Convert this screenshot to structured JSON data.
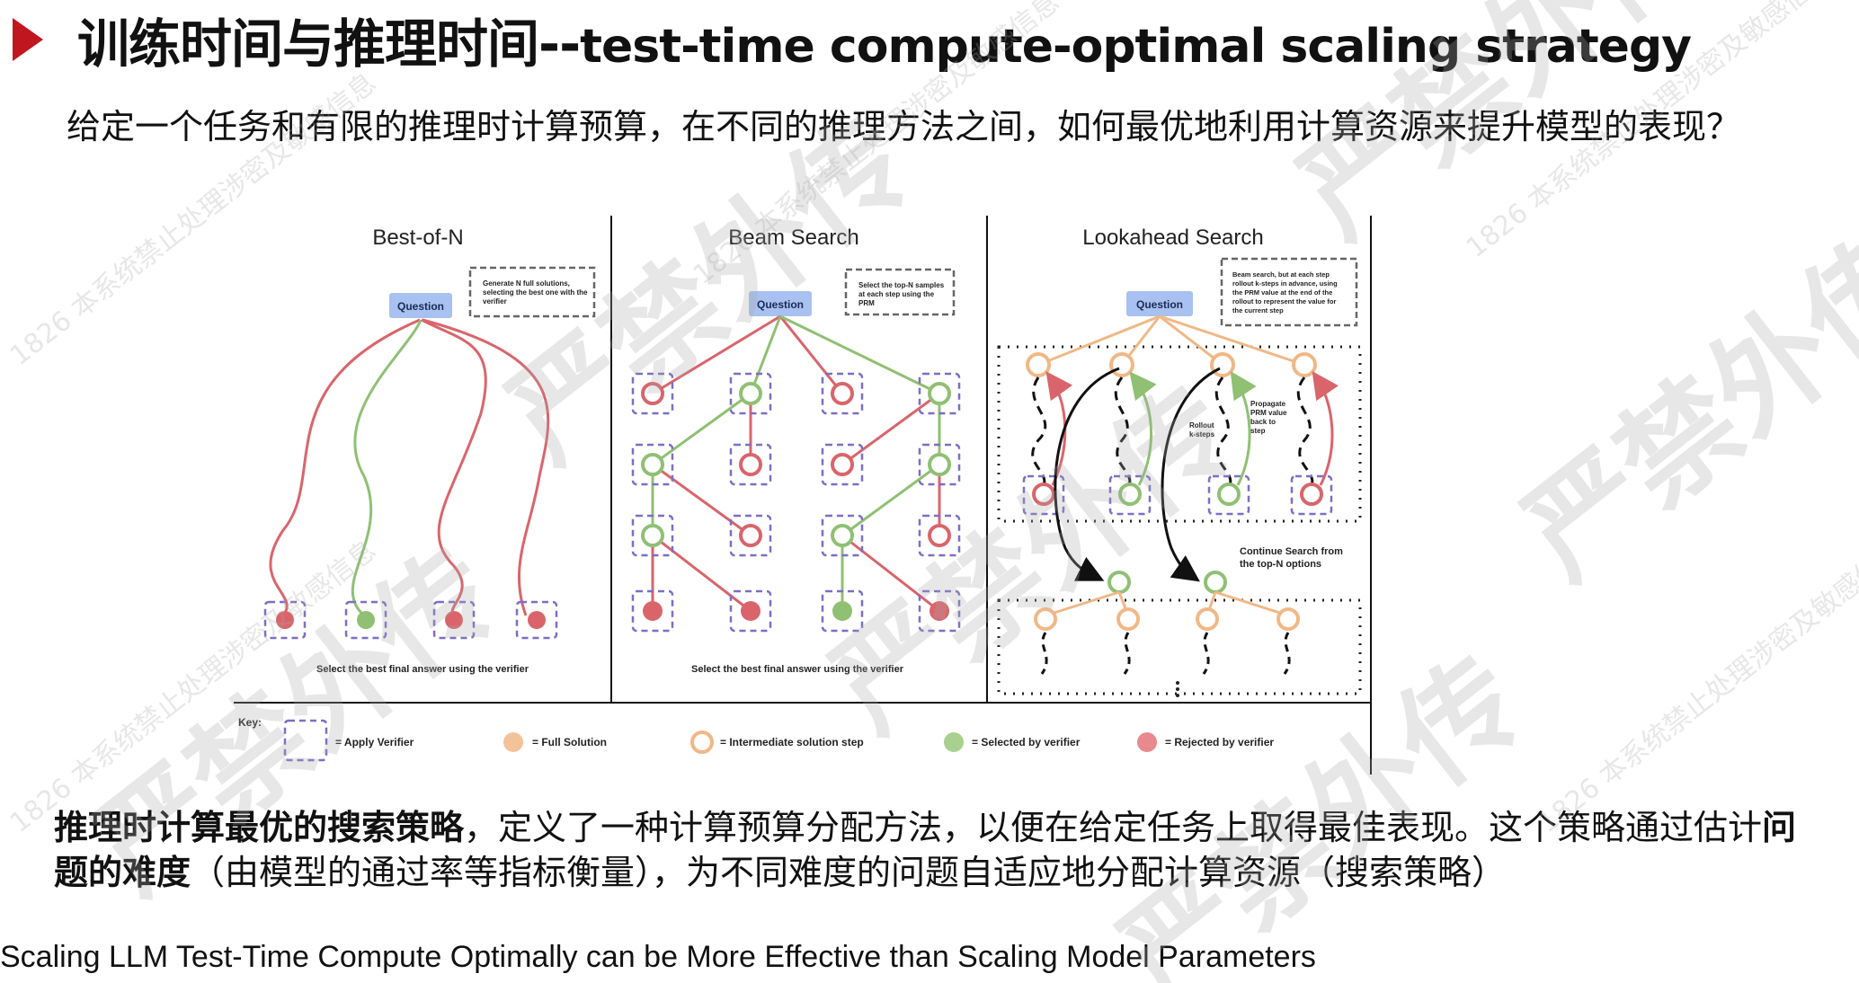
{
  "header": {
    "title_cn": "训练时间与推理时间--",
    "title_en": "test-time compute-optimal scaling strategy"
  },
  "subtitle": "给定一个任务和有限的推理时计算预算，在不同的推理方法之间，如何最优地利用计算资源来提升模型的表现？",
  "figure": {
    "panels": [
      {
        "title": "Best-of-N",
        "question": "Question",
        "note": [
          "Generate N full solutions,",
          "selecting the best one with the",
          "verifier"
        ],
        "caption": "Select the best final answer using the verifier"
      },
      {
        "title": "Beam Search",
        "question": "Question",
        "note": [
          "Select the top-N samples",
          "at each step using the",
          "PRM"
        ],
        "caption": "Select the best final answer using the verifier"
      },
      {
        "title": "Lookahead Search",
        "question": "Question",
        "note": [
          "Beam search, but at each step",
          "rollout k-steps in advance, using",
          "the PRM value at the end of the",
          "rollout to represent the value for",
          "the current step"
        ],
        "rollout_label": [
          "Rollout",
          "k-steps"
        ],
        "propagate_label": [
          "Propagate",
          "PRM value",
          "back to",
          "step"
        ],
        "continue_label": [
          "Continue Search from",
          "the top-N options"
        ]
      }
    ],
    "key": {
      "label": "Key:",
      "items": [
        {
          "label": "Apply Verifier",
          "icon": "dashed-box"
        },
        {
          "label": "Full Solution",
          "color": "#f3c29a"
        },
        {
          "label": "Intermediate solution step",
          "color": "#f3c29a"
        },
        {
          "label": "Selected by verifier",
          "color": "#a9d08e"
        },
        {
          "label": "Rejected by verifier",
          "color": "#e8898d"
        }
      ]
    },
    "colors": {
      "red": "#d9656b",
      "green": "#8fc073",
      "orange": "#f0b886",
      "purple": "#7b6fc7",
      "question_bg": "#a8c1f0"
    }
  },
  "paragraph": {
    "bold1": "推理时计算最优的搜索策略",
    "text1": "，定义了一种计算预算分配方法，以便在给定任务上取得最佳表现。这个策略通过估计",
    "bold2": "问题的难度",
    "text2": "（由模型的通过率等指标衡量），为不同难度的问题自适应地分配计算资源（搜索策略）"
  },
  "citation": "Scaling LLM Test-Time Compute Optimally can be More Effective than Scaling Model Parameters",
  "watermark": {
    "main": "严禁外传",
    "small": "1826 本系统禁止处理涉密及敏感信息"
  }
}
